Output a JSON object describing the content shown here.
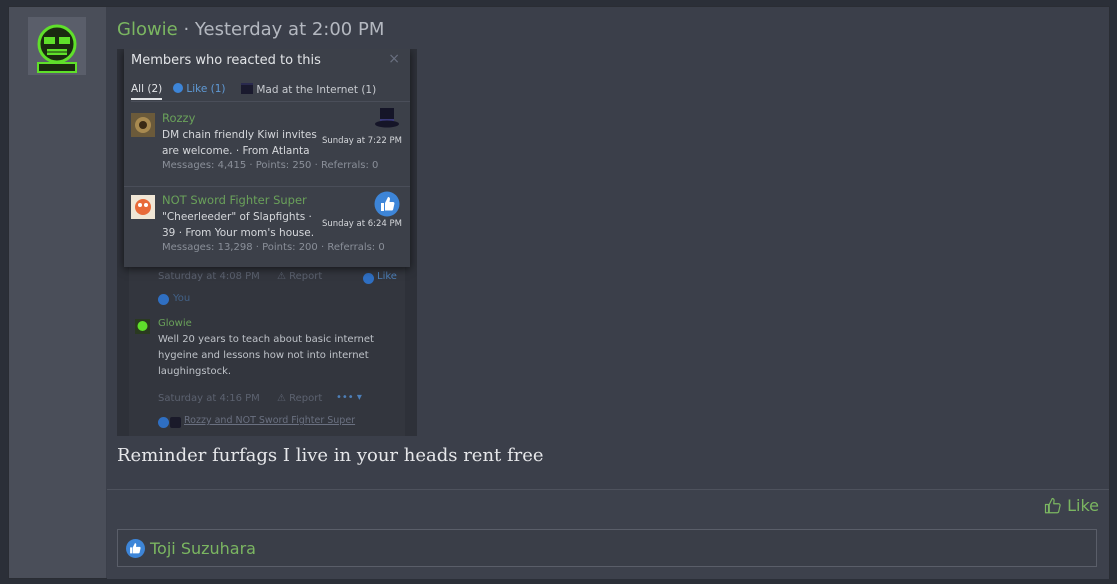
{
  "post": {
    "author": "Glowie",
    "timestamp": " · Yesterday at 2:00 PM",
    "message": "Reminder furfags I live in your heads rent free"
  },
  "embedded_screenshot": {
    "modal": {
      "title": "Members who reacted to this",
      "close_icon": "close-icon",
      "tabs": {
        "all": "All (2)",
        "like": "Like (1)",
        "mad": "Mad at the Internet (1)"
      },
      "reactors": [
        {
          "name": "Rozzy",
          "desc_line1": "DM chain friendly Kiwi invites",
          "desc_line2": "are welcome. · From Atlanta",
          "stats": "Messages: 4,415 · Points: 250 · Referrals: 0",
          "date": "Sunday at 7:22 PM",
          "reaction_icon": "top-hat-icon"
        },
        {
          "name": "NOT Sword Fighter Super",
          "desc_line1": "\"Cheerleeder\" of Slapfights ·",
          "desc_line2": "39 · From Your mom's house.",
          "stats": "Messages: 13,298 · Points: 200 · Referrals: 0",
          "date": "Sunday at 6:24 PM",
          "reaction_icon": "thumbs-up-icon"
        }
      ]
    },
    "background": {
      "meta1": "Saturday at 4:08 PM",
      "report1": "Report",
      "like1": "Like",
      "you": "You",
      "commenter": "Glowie",
      "comment_line1": "Well 20 years to teach about basic internet",
      "comment_line2": "hygeine and lessons how not into internet",
      "comment_line3": "laughingstock.",
      "meta2": "Saturday at 4:16 PM",
      "report2": "Report",
      "reactions_summary": "Rozzy and NOT Sword Fighter Super"
    }
  },
  "footer": {
    "like_label": "Like",
    "reactions": [
      {
        "name": "Toji Suzuhara",
        "icon": "thumbs-up-icon"
      }
    ]
  },
  "colors": {
    "username": "#7bb661",
    "like_blue": "#3d85d8",
    "background": "#3b3f4a"
  }
}
